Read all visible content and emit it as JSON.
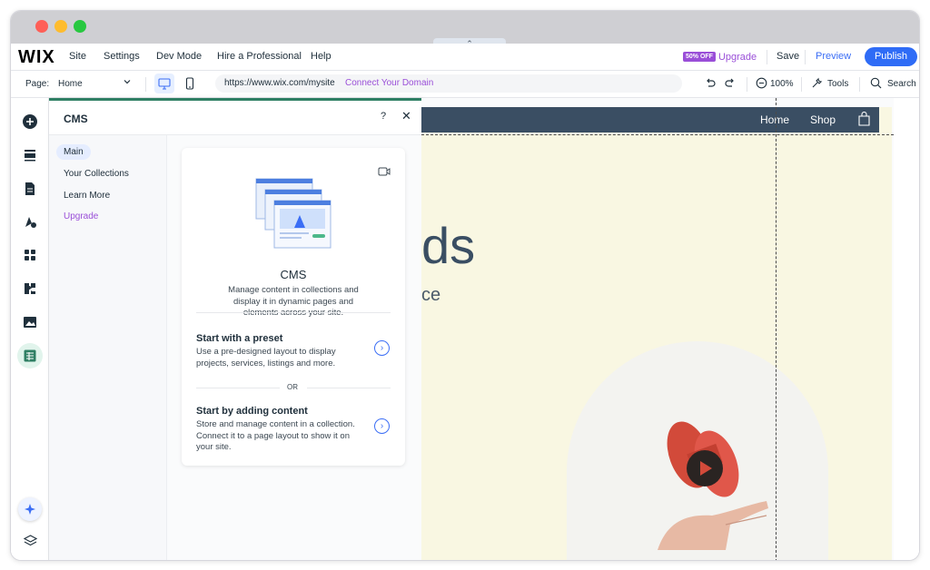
{
  "topbar": {
    "logo": "WIX",
    "menu": [
      "Site",
      "Settings",
      "Dev Mode",
      "Hire a Professional",
      "Help"
    ],
    "off_badge": "50% OFF",
    "upgrade": "Upgrade",
    "save": "Save",
    "preview": "Preview",
    "publish": "Publish"
  },
  "toolbar": {
    "page_label": "Page:",
    "page_value": "Home",
    "url": "https://www.wix.com/mysite",
    "connect_domain": "Connect Your Domain",
    "zoom": "100%",
    "tools": "Tools",
    "search": "Search"
  },
  "cms": {
    "title": "CMS",
    "help": "?",
    "close": "✕",
    "nav": [
      "Main",
      "Your Collections",
      "Learn More",
      "Upgrade"
    ],
    "card_title": "CMS",
    "card_desc": "Manage content in collections and display it in dynamic pages and elements across your site.",
    "option1_title": "Start with a preset",
    "option1_desc": "Use a pre-designed layout to display projects, services, listings and more.",
    "or": "OR",
    "option2_title": "Start by adding content",
    "option2_desc": "Store and manage content in a collection. Connect it to a page layout to show it on your site."
  },
  "site": {
    "nav": [
      "Home",
      "Shop"
    ],
    "hero": "ds",
    "hero_sub": "ce"
  },
  "colors": {
    "accent": "#2f6cf6",
    "purple": "#9a4fd8",
    "site_bg": "#f9f7e2",
    "site_nav": "#3a4e63",
    "cms_green": "#2f7f64"
  }
}
